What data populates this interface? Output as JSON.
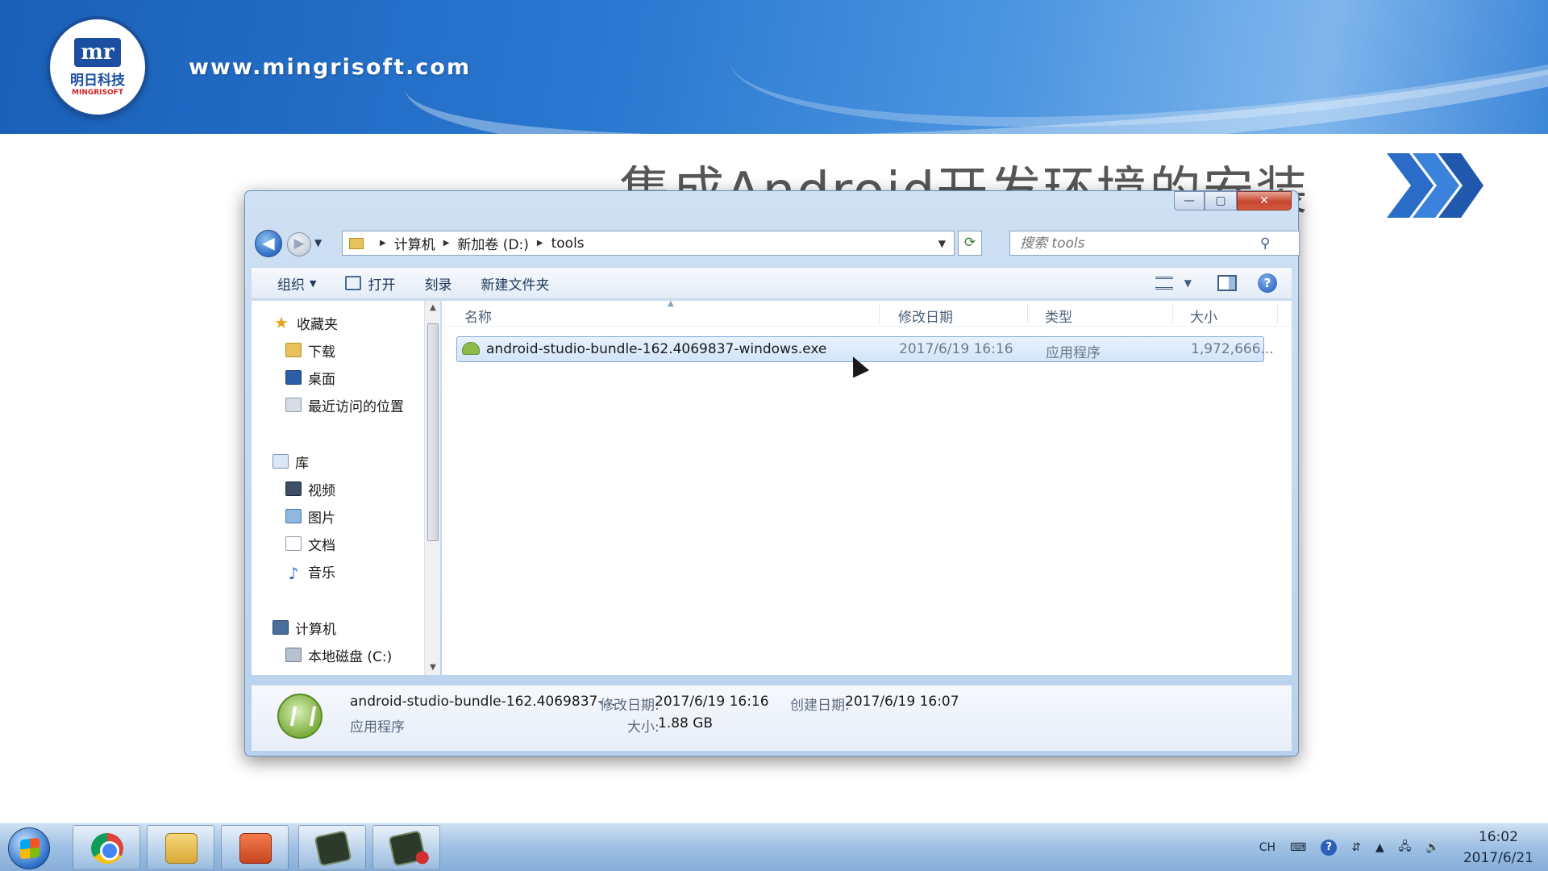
{
  "banner": {
    "logo_cn": "明日科技",
    "logo_en": "MINGRISOFT",
    "logo_mark": "mr",
    "url": "www.mingrisoft.com"
  },
  "slide": {
    "title": "集成Android开发环境的安装"
  },
  "window": {
    "controls": {
      "minimize": "—",
      "maximize": "▢",
      "close": "✕"
    },
    "address": {
      "crumbs": [
        "计算机",
        "新加卷 (D:)",
        "tools"
      ]
    },
    "search": {
      "placeholder": "搜索 tools"
    },
    "toolbar": {
      "organize": "组织",
      "open": "打开",
      "burn": "刻录",
      "new_folder": "新建文件夹"
    },
    "nav": {
      "favorites": "收藏夹",
      "downloads": "下载",
      "desktop": "桌面",
      "recent": "最近访问的位置",
      "libraries": "库",
      "videos": "视频",
      "pictures": "图片",
      "documents": "文档",
      "music": "音乐",
      "computer": "计算机",
      "local_disk": "本地磁盘 (C:)"
    },
    "columns": {
      "name": "名称",
      "modified": "修改日期",
      "type": "类型",
      "size": "大小"
    },
    "files": [
      {
        "name": "android-studio-bundle-162.4069837-windows.exe",
        "modified": "2017/6/19 16:16",
        "type": "应用程序",
        "size": "1,972,666..."
      }
    ],
    "details": {
      "name": "android-studio-bundle-162.4069837-...",
      "type": "应用程序",
      "modified_label": "修改日期:",
      "modified_value": "2017/6/19 16:16",
      "size_label": "大小:",
      "size_value": "1.88 GB",
      "created_label": "创建日期:",
      "created_value": "2017/6/19 16:07"
    }
  },
  "taskbar": {
    "apps": [
      "chrome-icon",
      "explorer-icon",
      "powerpoint-icon",
      "terminal-icon",
      "terminal-recording-icon"
    ],
    "tray": {
      "lang": "CH",
      "help": "?",
      "time": "16:02",
      "date": "2017/6/21"
    }
  }
}
